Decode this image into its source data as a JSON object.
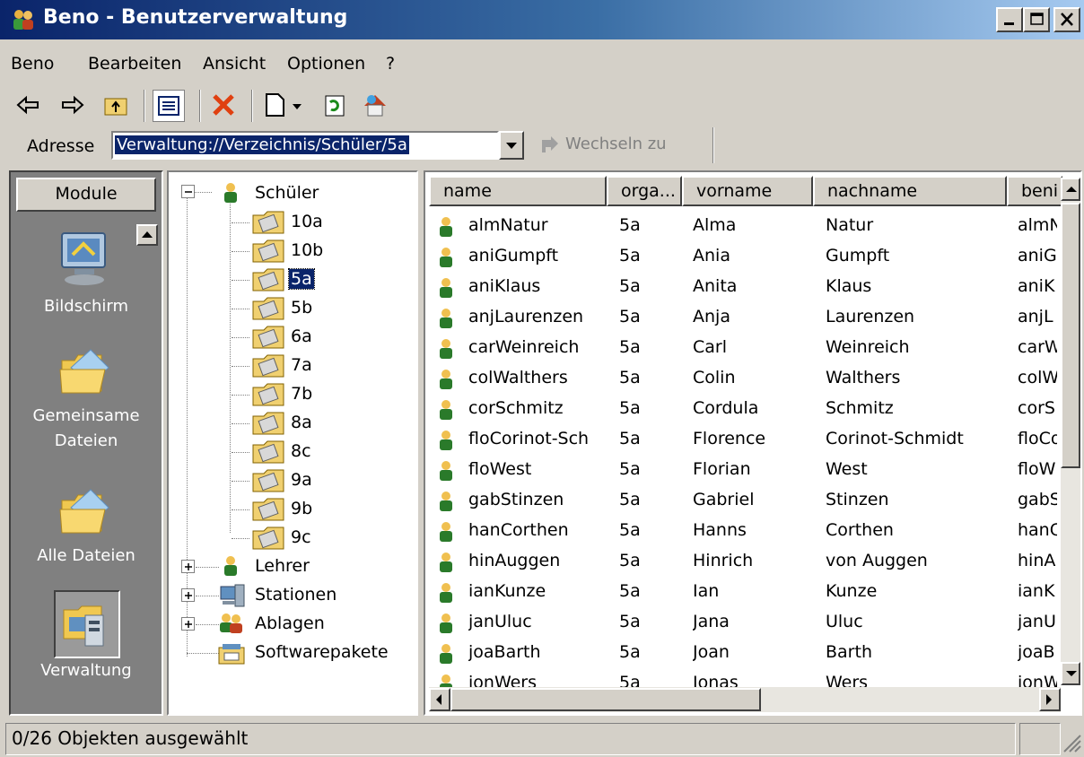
{
  "window": {
    "title": "Beno - Benutzerverwaltung"
  },
  "menu": [
    "Beno",
    "Bearbeiten",
    "Ansicht",
    "Optionen",
    "?"
  ],
  "toolbar": {
    "icons": [
      "back-arrow-icon",
      "forward-arrow-icon",
      "folder-up-icon",
      "list-view-icon",
      "delete-icon",
      "new-icon",
      "refresh-icon",
      "home-icon"
    ]
  },
  "address": {
    "label": "Adresse",
    "value": "Verwaltung://Verzeichnis/Schüler/5a",
    "go_label": "Wechseln zu"
  },
  "modules": {
    "header": "Module",
    "items": [
      {
        "label": "Bildschirm",
        "icon": "monitor-icon"
      },
      {
        "label": "Gemeinsame Dateien",
        "icon": "shared-folder-icon"
      },
      {
        "label": "Alle Dateien",
        "icon": "folder-icon"
      },
      {
        "label": "Verwaltung",
        "icon": "admin-icon"
      }
    ]
  },
  "tree": {
    "root": {
      "label": "Schüler",
      "expanded": true
    },
    "classes": [
      "10a",
      "10b",
      "5a",
      "5b",
      "6a",
      "7a",
      "7b",
      "8a",
      "8c",
      "9a",
      "9b",
      "9c"
    ],
    "selected": "5a",
    "others": [
      {
        "label": "Lehrer",
        "collapsed": true
      },
      {
        "label": "Stationen",
        "collapsed": true
      },
      {
        "label": "Ablagen",
        "collapsed": true
      },
      {
        "label": "Softwarepakete"
      }
    ]
  },
  "list": {
    "columns": [
      "name",
      "orga...",
      "vorname",
      "nachname",
      "beni"
    ],
    "rows": [
      [
        "almNatur",
        "5a",
        "Alma",
        "Natur",
        "almN"
      ],
      [
        "aniGumpft",
        "5a",
        "Ania",
        "Gumpft",
        "aniG"
      ],
      [
        "aniKlaus",
        "5a",
        "Anita",
        "Klaus",
        "aniK"
      ],
      [
        "anjLaurenzen",
        "5a",
        "Anja",
        "Laurenzen",
        "anjL"
      ],
      [
        "carWeinreich",
        "5a",
        "Carl",
        "Weinreich",
        "carW"
      ],
      [
        "colWalthers",
        "5a",
        "Colin",
        "Walthers",
        "colW"
      ],
      [
        "corSchmitz",
        "5a",
        "Cordula",
        "Schmitz",
        "corS"
      ],
      [
        "floCorinot-Sch",
        "5a",
        "Florence",
        "Corinot-Schmidt",
        "floCo"
      ],
      [
        "floWest",
        "5a",
        "Florian",
        "West",
        "floW"
      ],
      [
        "gabStinzen",
        "5a",
        "Gabriel",
        "Stinzen",
        "gabS"
      ],
      [
        "hanCorthen",
        "5a",
        "Hanns",
        "Corthen",
        "hanC"
      ],
      [
        "hinAuggen",
        "5a",
        "Hinrich",
        "von Auggen",
        "hinA"
      ],
      [
        "ianKunze",
        "5a",
        "Ian",
        "Kunze",
        "ianK"
      ],
      [
        "janUluc",
        "5a",
        "Jana",
        "Uluc",
        "janU"
      ],
      [
        "joaBarth",
        "5a",
        "Joan",
        "Barth",
        "joaB"
      ],
      [
        "jonWers",
        "5a",
        "Jonas",
        "Wers",
        "jonW"
      ]
    ]
  },
  "status": {
    "text": "0/26 Objekten ausgewählt"
  },
  "colors": {
    "titlebar": "#0a246a",
    "selection": "#0a246a",
    "chrome": "#d4d0c8",
    "modules_bg": "#808080"
  }
}
